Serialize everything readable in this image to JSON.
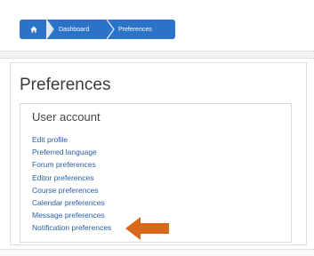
{
  "breadcrumb": {
    "home_icon": "home-icon",
    "items": [
      "Dashboard",
      "Preferences"
    ]
  },
  "page": {
    "title": "Preferences"
  },
  "user_account": {
    "heading": "User account",
    "links": [
      "Edit profile",
      "Preferred language",
      "Forum preferences",
      "Editor preferences",
      "Course preferences",
      "Calendar preferences",
      "Message preferences",
      "Notification preferences"
    ]
  },
  "annotation": {
    "arrow_icon": "left-arrow-icon",
    "color": "#d9691a"
  },
  "colors": {
    "breadcrumb": "#2a73c8",
    "link": "#2b5ea0"
  }
}
